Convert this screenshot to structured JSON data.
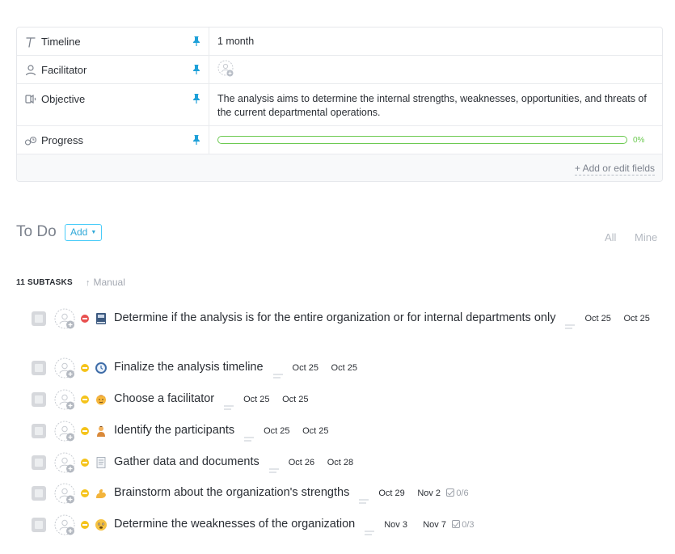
{
  "fields": {
    "timeline": {
      "label": "Timeline",
      "icon": "text-icon",
      "value": "1 month"
    },
    "facilitator": {
      "label": "Facilitator",
      "icon": "person-icon"
    },
    "objective": {
      "label": "Objective",
      "icon": "speaker-icon",
      "value": "The analysis aims to determine the internal strengths, weaknesses, opportunities, and threats of the current departmental operations."
    },
    "progress": {
      "label": "Progress",
      "icon": "progress-icon",
      "value_label": "0%",
      "value": 0,
      "color": "#6bc950"
    },
    "add_fields_label": "+ Add or edit fields",
    "pin_color": "#1ea0d8"
  },
  "todo": {
    "title": "To Do",
    "add_label": "Add",
    "filter_all": "All",
    "filter_mine": "Mine",
    "subtask_count_label": "11 SUBTASKS",
    "sort_label": "Manual"
  },
  "tasks": [
    {
      "name": "Determine if the analysis is for the entire organization or for internal departments only",
      "priority": "urgent",
      "emoji": "book-icon",
      "start": "Oct 25",
      "due": "Oct 25",
      "checklist": ""
    },
    {
      "name": "Finalize the analysis timeline",
      "priority": "normal",
      "emoji": "clock-icon",
      "start": "Oct 25",
      "due": "Oct 25",
      "checklist": ""
    },
    {
      "name": "Choose a facilitator",
      "priority": "normal",
      "emoji": "face-icon",
      "start": "Oct 25",
      "due": "Oct 25",
      "checklist": ""
    },
    {
      "name": "Identify the participants",
      "priority": "normal",
      "emoji": "person-icon",
      "start": "Oct 25",
      "due": "Oct 25",
      "checklist": ""
    },
    {
      "name": "Gather data and documents",
      "priority": "normal",
      "emoji": "document-icon",
      "start": "Oct 26",
      "due": "Oct 28",
      "checklist": ""
    },
    {
      "name": "Brainstorm about the organization's strengths",
      "priority": "normal",
      "emoji": "flexed-arm-icon",
      "start": "Oct 29",
      "due": "Nov 2",
      "checklist": "0/6"
    },
    {
      "name": "Determine the weaknesses of the organization",
      "priority": "normal",
      "emoji": "worried-face-icon",
      "start": "Nov 3",
      "due": "Nov 7",
      "checklist": "0/3"
    }
  ]
}
